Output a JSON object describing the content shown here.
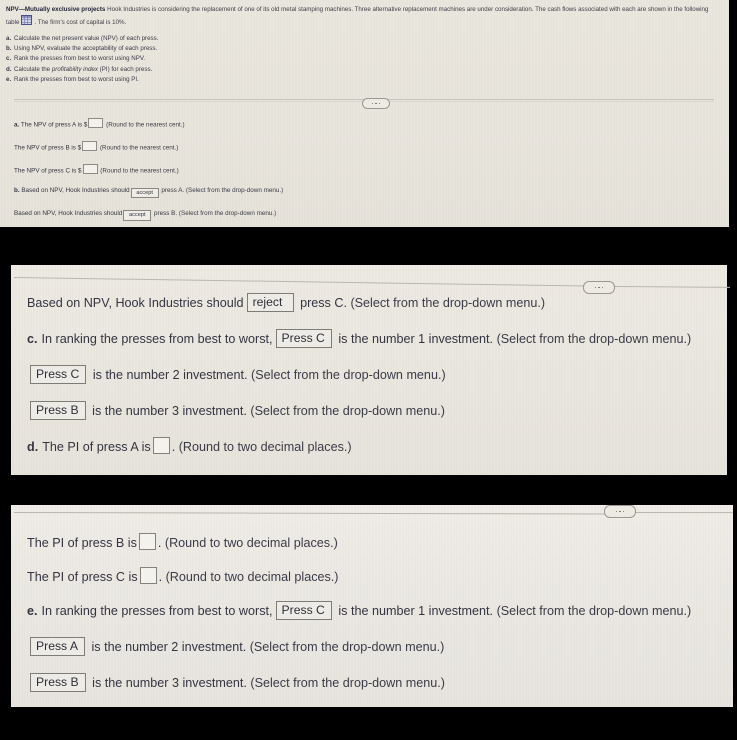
{
  "problem": {
    "title": "NPV—Mutually exclusive projects",
    "statement_1": "Hook Industries is considering the replacement of one of its old metal stamping machines.  Three alternative replacement machines are under consideration.  The cash flows associated with each are shown in the following table",
    "statement_2": ". The firm's cost of capital is 10%.",
    "table_icon": "table-grid-icon",
    "tasks": [
      {
        "label": "a.",
        "text": "Calculate the net present value (NPV) of each press."
      },
      {
        "label": "b.",
        "text": "Using NPV, evaluate the acceptability of each press."
      },
      {
        "label": "c.",
        "text": "Rank the presses from best to worst using NPV."
      },
      {
        "label": "d.",
        "text_pre": "Calculate the ",
        "text_italic": "profitability index",
        "text_post": " (PI) for each press."
      },
      {
        "label": "e.",
        "text": "Rank the presses from best to worst using PI."
      }
    ]
  },
  "panel1": {
    "ellipsis_label": "…",
    "rows": [
      {
        "letter": "a.",
        "pre": "The NPV of press A is $",
        "value": "",
        "post": "(Round to the nearest cent.)",
        "type": "input"
      },
      {
        "letter": "",
        "pre": "The NPV of press B is $",
        "value": "",
        "post": "(Round to the nearest cent.)",
        "type": "input"
      },
      {
        "letter": "",
        "pre": "The NPV of press C is $",
        "value": "",
        "post": "(Round to the nearest cent.)",
        "type": "input"
      },
      {
        "letter": "b.",
        "pre": "Based on NPV, Hook Industries should",
        "value": "accept",
        "mid": "press A.",
        "post": "(Select from the drop-down menu.)",
        "type": "select"
      },
      {
        "letter": "",
        "pre": "Based on NPV, Hook Industries should",
        "value": "accept",
        "mid": "press B.",
        "post": "(Select from the drop-down menu.)",
        "type": "select"
      }
    ]
  },
  "panel2": {
    "ellipsis_label": "…",
    "rows": [
      {
        "letter": "",
        "pre": "Based on NPV, Hook Industries should",
        "value": "reject",
        "mid": "press C.",
        "post": "(Select from the drop-down menu.)",
        "type": "select"
      },
      {
        "letter": "c.",
        "pre": "In ranking the presses from best to worst,",
        "value": "Press C",
        "mid": "is the number 1 investment.",
        "post": "(Select from the drop-down menu.)",
        "type": "select"
      },
      {
        "letter": "",
        "pre": "",
        "value": "Press C",
        "mid": "is the number 2 investment.",
        "post": "(Select from the drop-down menu.)",
        "type": "select"
      },
      {
        "letter": "",
        "pre": "",
        "value": "Press B",
        "mid": "is the number 3 investment.",
        "post": "(Select from the drop-down menu.)",
        "type": "select"
      },
      {
        "letter": "d.",
        "pre": "The PI of press A is",
        "value": "",
        "mid": ".",
        "post": "(Round to two decimal places.)",
        "type": "input"
      }
    ]
  },
  "panel3": {
    "ellipsis_label": "…",
    "rows": [
      {
        "letter": "",
        "pre": "The PI of press B is",
        "value": "",
        "mid": ".",
        "post": "(Round to two decimal places.)",
        "type": "input"
      },
      {
        "letter": "",
        "pre": "The PI of press C is",
        "value": "",
        "mid": ".",
        "post": "(Round to two decimal places.)",
        "type": "input"
      },
      {
        "letter": "e.",
        "pre": "In ranking the presses from best to worst,",
        "value": "Press C",
        "mid": "is the number 1 investment.",
        "post": "(Select from the drop-down menu.)",
        "type": "select"
      },
      {
        "letter": "",
        "pre": "",
        "value": "Press A",
        "mid": "is the number 2 investment.",
        "post": "(Select from the drop-down menu.)",
        "type": "select"
      },
      {
        "letter": "",
        "pre": "",
        "value": "Press B",
        "mid": "is the number 3 investment.",
        "post": "(Select from the drop-down menu.)",
        "type": "select"
      }
    ]
  },
  "colors": {
    "background": "#000000",
    "panel": "#e9e6dd",
    "text": "#343442",
    "field_border": "#85827c",
    "icon_blue": "#5d63a6"
  }
}
